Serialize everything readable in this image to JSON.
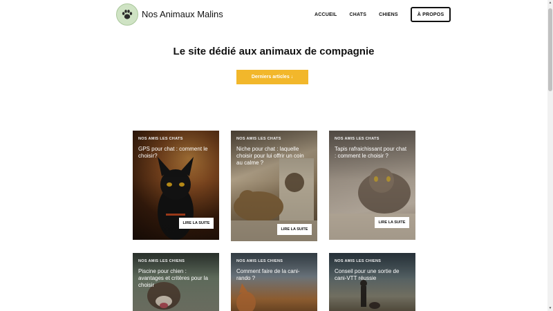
{
  "header": {
    "site_title": "Nos Animaux Malins",
    "nav": [
      "ACCUEIL",
      "CHATS",
      "CHIENS"
    ],
    "about": "À PROPOS"
  },
  "hero": {
    "title": "Le site dédié aux animaux de compagnie",
    "cta": "Derniers articles ↓"
  },
  "cards": [
    {
      "category": "NOS AMIS LES CHATS",
      "title": "GPS pour chat : comment le choisir?",
      "button": "LIRE LA SUITE"
    },
    {
      "category": "NOS AMIS LES CHATS",
      "title": "Niche pour chat : laquelle choisir pour lui offrir un coin au calme ?",
      "button": "LIRE LA SUITE"
    },
    {
      "category": "NOS AMIS LES CHATS",
      "title": "Tapis rafraichissant pour chat : comment le choisir ?",
      "button": "LIRE LA SUITE"
    },
    {
      "category": "NOS AMIS LES CHIENS",
      "title": "Piscine pour chien : avantages et critères pour la choisir"
    },
    {
      "category": "NOS AMIS LES CHIENS",
      "title": "Comment faire de la cani-rando ?"
    },
    {
      "category": "NOS AMIS LES CHIENS",
      "title": "Conseil pour une sortie de cani-VTT réussie"
    }
  ],
  "colors": {
    "accent": "#f2b72b",
    "logo_bg": "#cfe3c4"
  },
  "icons": {
    "logo": "paw-icon"
  }
}
